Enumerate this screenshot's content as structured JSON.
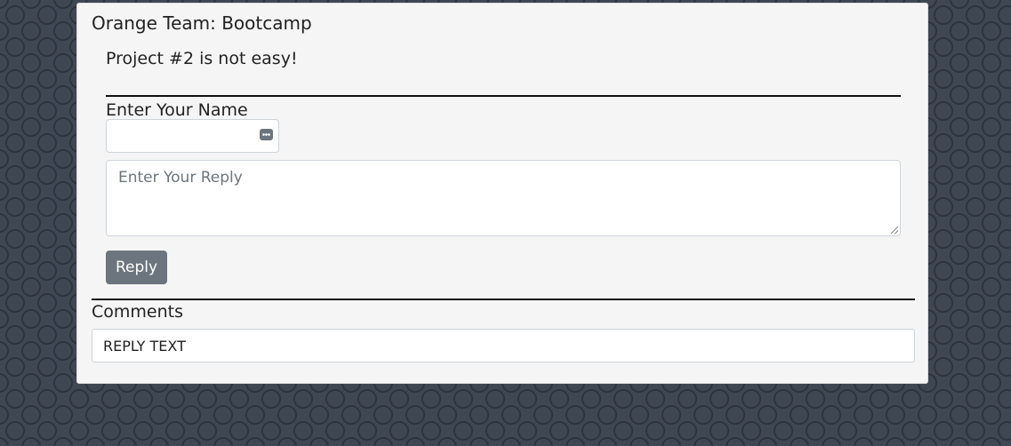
{
  "card": {
    "title": "Orange Team: Bootcamp"
  },
  "post": {
    "title": "Project #2 is not easy!"
  },
  "form": {
    "name_label": "Enter Your Name",
    "name_value": "",
    "reply_placeholder": "Enter Your Reply",
    "reply_button": "Reply"
  },
  "comments": {
    "label": "Comments",
    "items": [
      {
        "text": "REPLY TEXT"
      }
    ]
  },
  "icons": {
    "autofill": "autofill-key-icon"
  },
  "colors": {
    "background": "#3f4753",
    "card": "#f5f5f5",
    "button": "#6c757d",
    "placeholder": "#6c757d"
  }
}
